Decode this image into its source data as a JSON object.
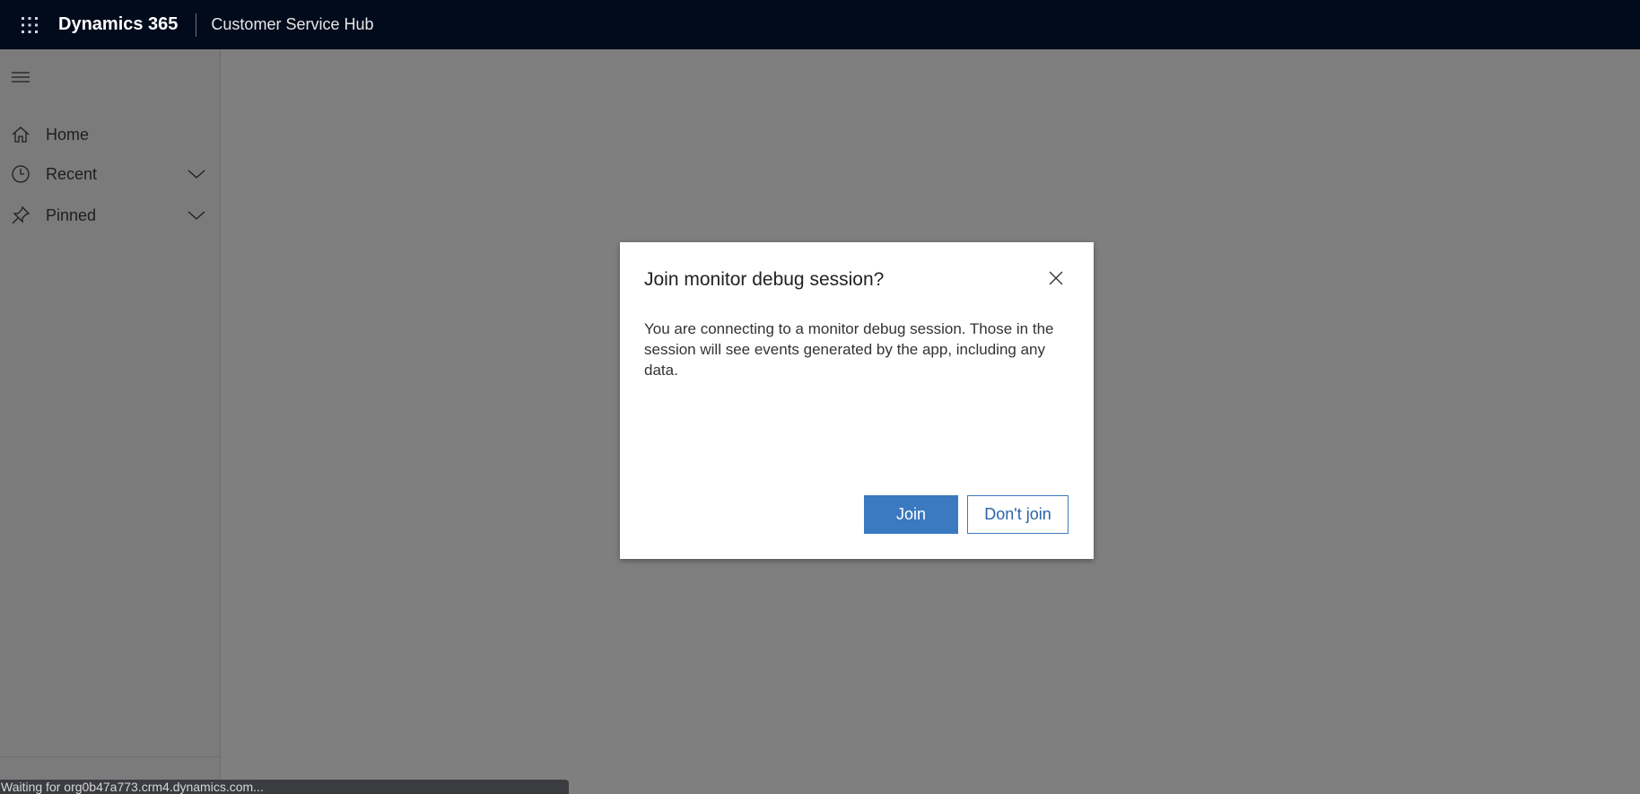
{
  "header": {
    "brand": "Dynamics 365",
    "app_name": "Customer Service Hub"
  },
  "sidebar": {
    "items": [
      {
        "label": "Home",
        "icon": "home-icon"
      },
      {
        "label": "Recent",
        "icon": "clock-icon",
        "expandable": true
      },
      {
        "label": "Pinned",
        "icon": "pin-icon",
        "expandable": true
      }
    ]
  },
  "dialog": {
    "title": "Join monitor debug session?",
    "body": "You are connecting to a monitor debug session. Those in the session will see events generated by the app, including any data.",
    "join_label": "Join",
    "dont_join_label": "Don't join"
  },
  "status_bar": {
    "text": "Waiting for org0b47a773.crm4.dynamics.com..."
  },
  "colors": {
    "topbar": "#020b1c",
    "overlay": "#7f7f7f",
    "primary_button": "#3b79c0"
  }
}
